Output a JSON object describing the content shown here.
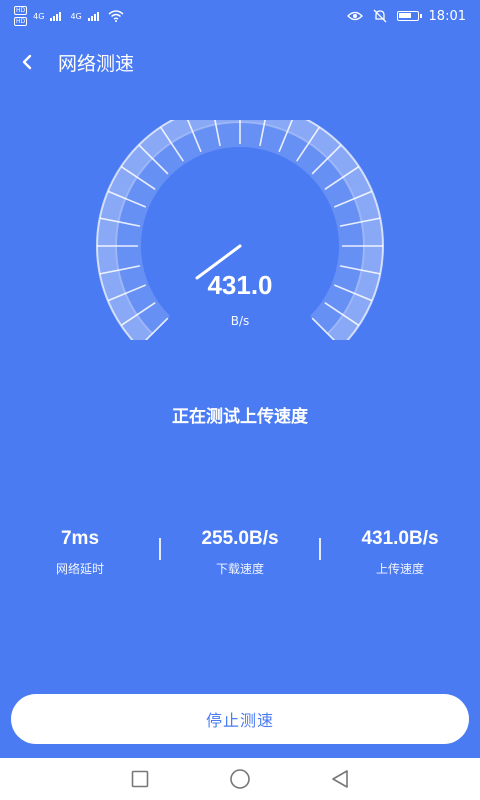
{
  "status_bar": {
    "hd1": "HD",
    "hd2": "HD",
    "net1": "4G",
    "net2": "4G",
    "time": "18:01"
  },
  "app_bar": {
    "title": "网络测速"
  },
  "gauge": {
    "value": "431.0",
    "unit": "B/s"
  },
  "status_text": "正在测试上传速度",
  "stats": [
    {
      "value": "7ms",
      "label": "网络延时"
    },
    {
      "value": "255.0B/s",
      "label": "下载速度"
    },
    {
      "value": "431.0B/s",
      "label": "上传速度"
    }
  ],
  "stop_button": {
    "label": "停止测速"
  },
  "colors": {
    "background": "#4a7bf3",
    "foreground": "#ffffff"
  }
}
